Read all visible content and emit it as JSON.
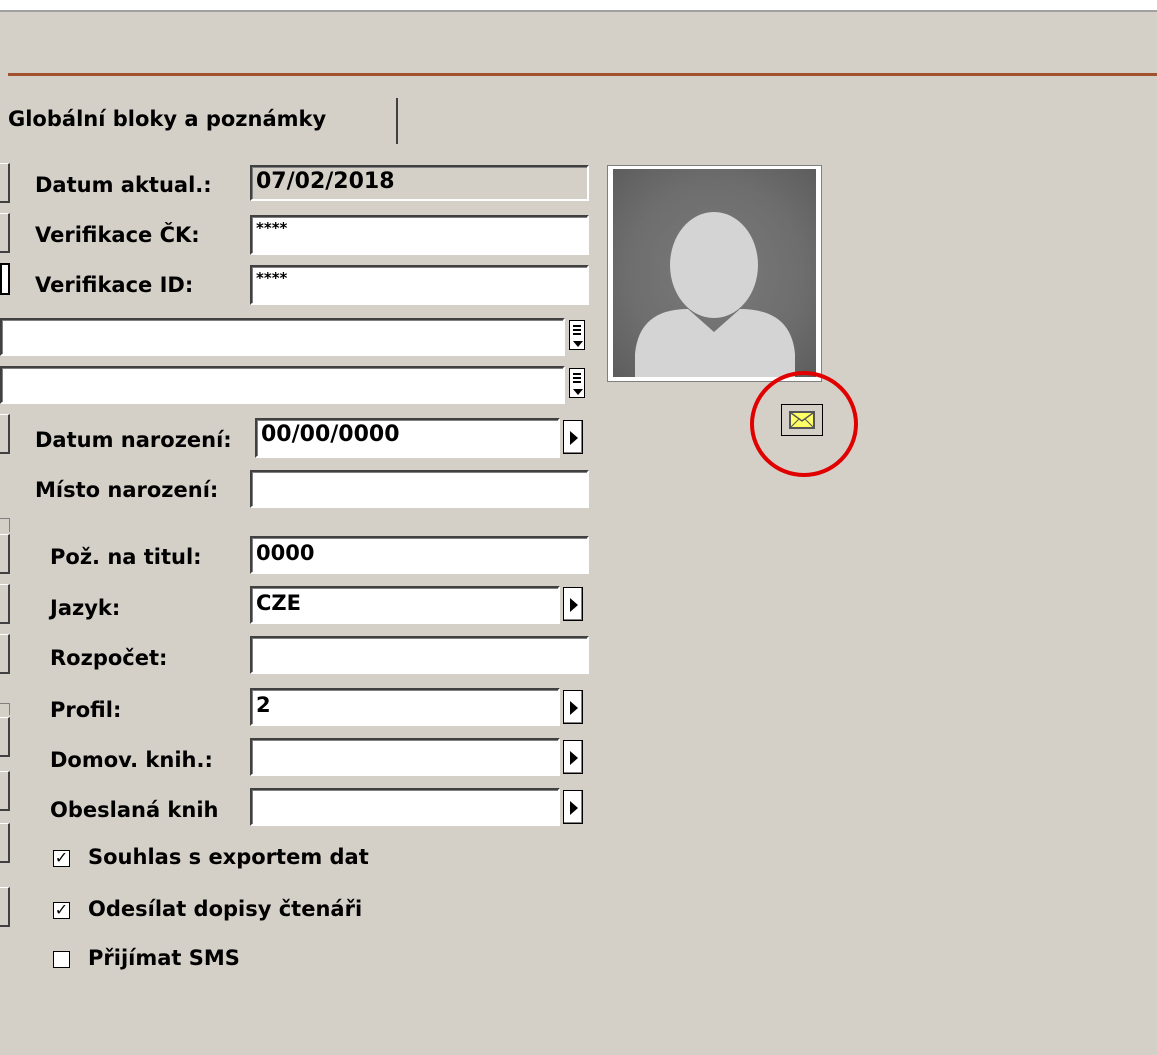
{
  "tab": {
    "label": "Globální bloky a poznámky"
  },
  "form": {
    "datum_aktual": {
      "label": "Datum aktual.:",
      "value": "07/02/2018"
    },
    "verifikace_ck": {
      "label": "Verifikace ČK:",
      "value": "****"
    },
    "verifikace_id": {
      "label": "Verifikace ID:",
      "value": "****"
    },
    "datum_narozeni": {
      "label": "Datum narození:",
      "value": "00/00/0000"
    },
    "misto_narozeni": {
      "label": "Místo narození:",
      "value": ""
    },
    "poz_na_titul": {
      "label": "Pož. na titul:",
      "value": "0000"
    },
    "jazyk": {
      "label": "Jazyk:",
      "value": "CZE"
    },
    "rozpocet": {
      "label": "Rozpočet:",
      "value": ""
    },
    "profil": {
      "label": "Profil:",
      "value": "2"
    },
    "domov_knih": {
      "label": "Domov. knih.:",
      "value": ""
    },
    "obeslana_knih": {
      "label": "Obeslaná knih",
      "value": ""
    }
  },
  "checkboxes": [
    {
      "label": "Souhlas s exportem dat",
      "checked": true,
      "mark": "✓"
    },
    {
      "label": "Odesílat dopisy čtenáři",
      "checked": true,
      "mark": "✓"
    },
    {
      "label": "Přijímat SMS",
      "checked": false,
      "mark": ""
    }
  ],
  "icons": {
    "photo": "person-silhouette-icon",
    "mail": "envelope-icon",
    "dropdown": "arrow-right-icon",
    "list": "list-picker-icon"
  },
  "colors": {
    "background": "#d4d0c8",
    "accent_line": "#a0522d",
    "highlight_circle": "#e00000"
  }
}
